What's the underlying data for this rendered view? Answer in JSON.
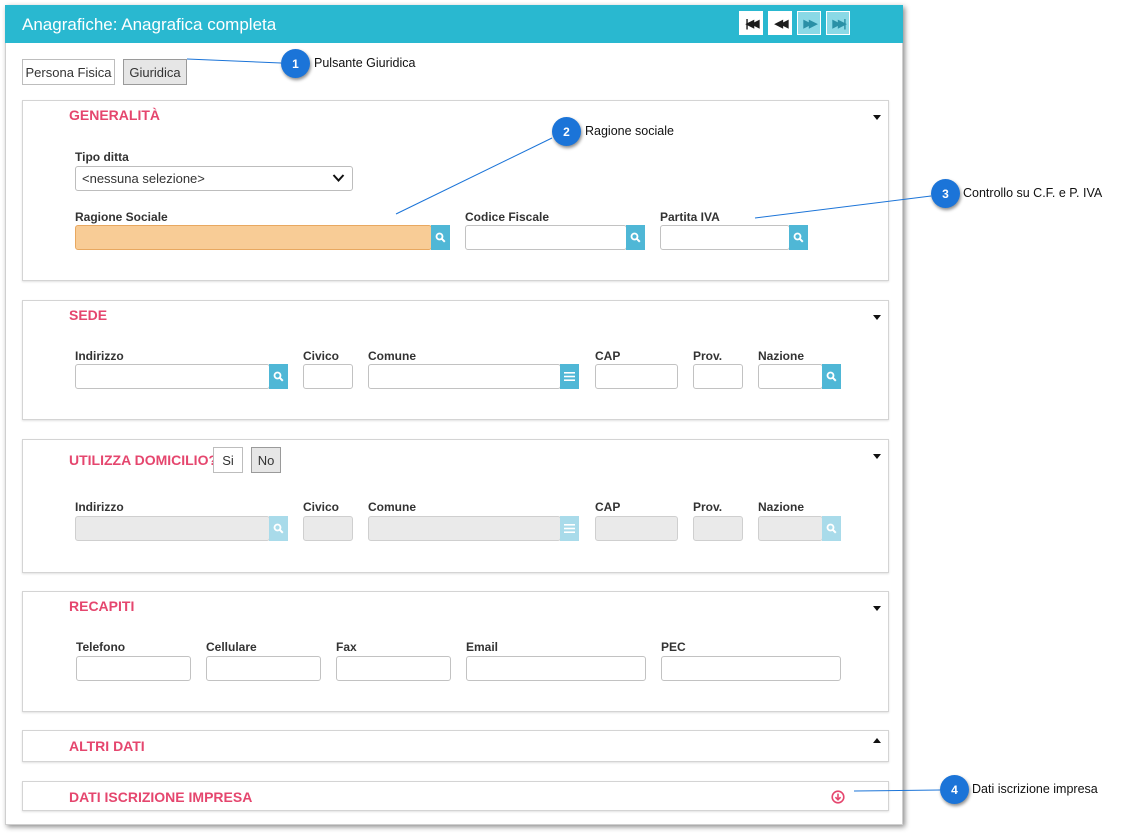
{
  "window": {
    "title": "Anagrafiche: Anagrafica completa",
    "nav": {
      "first_icon": "skip-first-icon",
      "prev_icon": "rewind-icon",
      "next_icon": "fast-forward-icon",
      "last_icon": "skip-last-icon"
    }
  },
  "type_toggle": {
    "persona_fisica": "Persona Fisica",
    "giuridica": "Giuridica",
    "selected": "Giuridica"
  },
  "generalita": {
    "title": "GENERALITÀ",
    "tipo_ditta_label": "Tipo ditta",
    "tipo_ditta_value": "<nessuna selezione>",
    "ragione_sociale_label": "Ragione Sociale",
    "codice_fiscale_label": "Codice Fiscale",
    "partita_iva_label": "Partita IVA",
    "highlight_color": "#f8cc96"
  },
  "sede": {
    "title": "SEDE",
    "indirizzo_label": "Indirizzo",
    "civico_label": "Civico",
    "comune_label": "Comune",
    "cap_label": "CAP",
    "prov_label": "Prov.",
    "nazione_label": "Nazione"
  },
  "domicilio": {
    "title": "UTILIZZA DOMICILIO?",
    "si_label": "Si",
    "no_label": "No",
    "selected": "No",
    "indirizzo_label": "Indirizzo",
    "civico_label": "Civico",
    "comune_label": "Comune",
    "cap_label": "CAP",
    "prov_label": "Prov.",
    "nazione_label": "Nazione"
  },
  "recapiti": {
    "title": "RECAPITI",
    "telefono_label": "Telefono",
    "cellulare_label": "Cellulare",
    "fax_label": "Fax",
    "email_label": "Email",
    "pec_label": "PEC"
  },
  "altri_dati": {
    "title": "ALTRI DATI"
  },
  "dati_iscrizione": {
    "title": "DATI ISCRIZIONE IMPRESA"
  },
  "callouts": [
    {
      "number": "1",
      "text": "Pulsante Giuridica"
    },
    {
      "number": "2",
      "text": "Ragione sociale"
    },
    {
      "number": "3",
      "text": "Controllo su C.F. e P. IVA"
    },
    {
      "number": "4",
      "text": "Dati iscrizione impresa"
    }
  ],
  "colors": {
    "titlebar": "#29b8d0",
    "section_title": "#e5466e",
    "callout_badge": "#1b74d8",
    "lookup_button": "#4fb7d6"
  }
}
